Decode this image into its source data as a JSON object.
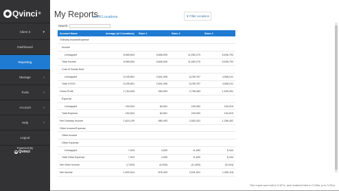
{
  "sidebar": {
    "brand": "Qvinci",
    "client": "Client 3",
    "items": [
      {
        "label": "Dashboard",
        "chevron": ""
      },
      {
        "label": "Reporting",
        "chevron": "",
        "active": true
      },
      {
        "label": "Manage",
        "chevron": "›"
      },
      {
        "label": "Tools",
        "chevron": "›"
      },
      {
        "label": "Account",
        "chevron": "›"
      },
      {
        "label": "Help",
        "chevron": "›"
      },
      {
        "label": "Logout",
        "chevron": ""
      }
    ],
    "powered_by": "Powered By",
    "powered_brand": "Qvinci"
  },
  "header": {
    "title": "My Reports",
    "subtitle": "on All Locations",
    "filter_label": "Filter Locations"
  },
  "search": {
    "label": "Search:",
    "value": "",
    "placeholder": ""
  },
  "table": {
    "columns": [
      "Account Name",
      "Average (of 3 locations)",
      "Store 1",
      "Store 2",
      "Store 3"
    ],
    "rows": [
      {
        "indent": 0,
        "cells": [
          "Ordinary Income/Expense",
          "",
          "",
          "",
          ""
        ]
      },
      {
        "indent": 1,
        "cells": [
          "Income",
          "",
          "",
          "",
          ""
        ]
      },
      {
        "indent": 2,
        "cells": [
          "Unmapped",
          "6,965,694",
          "5,806,000",
          "11,550,270",
          "6,636,793"
        ]
      },
      {
        "indent": 1,
        "total": true,
        "cells": [
          "Total Income",
          "6,965,694",
          "5,806,000",
          "11,550,270",
          "6,636,793"
        ]
      },
      {
        "indent": 1,
        "cells": [
          "Cost of Goods Sold",
          "",
          "",
          "",
          ""
        ]
      },
      {
        "indent": 2,
        "cells": [
          "Unmapped",
          "5,195,801",
          "2,841,006",
          "8,239,767",
          "4,506,011"
        ]
      },
      {
        "indent": 1,
        "total": true,
        "cells": [
          "Total COGS",
          "5,195,801",
          "2,841,006",
          "8,239,767",
          "4,506,011"
        ]
      },
      {
        "indent": 0,
        "cells": [
          "Gross Profit",
          "1,764,633",
          "964,994",
          "2,798,483",
          "1,525,451"
        ]
      },
      {
        "indent": 1,
        "cells": [
          "Expense",
          "",
          "",
          "",
          ""
        ]
      },
      {
        "indent": 2,
        "cells": [
          "Unmapped",
          "154,524",
          "84,501",
          "249,053",
          "164,019"
        ]
      },
      {
        "indent": 1,
        "total": true,
        "cells": [
          "Total Expense",
          "154,524",
          "84,501",
          "249,053",
          "164,019"
        ]
      },
      {
        "indent": 0,
        "cells": [
          "Net Ordinary Income",
          "1,610,109",
          "880,493",
          "2,553,431",
          "1,396,402"
        ]
      },
      {
        "indent": 0,
        "cells": [
          "Other Income/Expense",
          "",
          "",
          "",
          ""
        ]
      },
      {
        "indent": 1,
        "cells": [
          "Other Income",
          "",
          "",
          "",
          ""
        ]
      },
      {
        "indent": 1,
        "cells": [
          "Other Expense",
          "",
          "",
          "",
          ""
        ]
      },
      {
        "indent": 2,
        "cells": [
          "Unmapped",
          "7,515",
          "4,000",
          "11,600",
          "6,344"
        ]
      },
      {
        "indent": 1,
        "total": true,
        "cells": [
          "Total Other Expense",
          "7,515",
          "4,000",
          "11,600",
          "6,344"
        ]
      },
      {
        "indent": 0,
        "cells": [
          "Net Other Income",
          "(7,515)",
          "(4,000)",
          "(11,600)",
          "(6,344)"
        ]
      },
      {
        "indent": 0,
        "cells": [
          "Net Income",
          "1,602,614",
          "876,493",
          "2,541,831",
          "1,390,118"
        ]
      }
    ]
  },
  "footer": "This report was built in 0.327s, and rendered html in 0.249s, js in 0.001s",
  "colors": {
    "sidebar_bg": "#333336",
    "accent": "#1f7bd1",
    "link": "#3a86c9"
  }
}
